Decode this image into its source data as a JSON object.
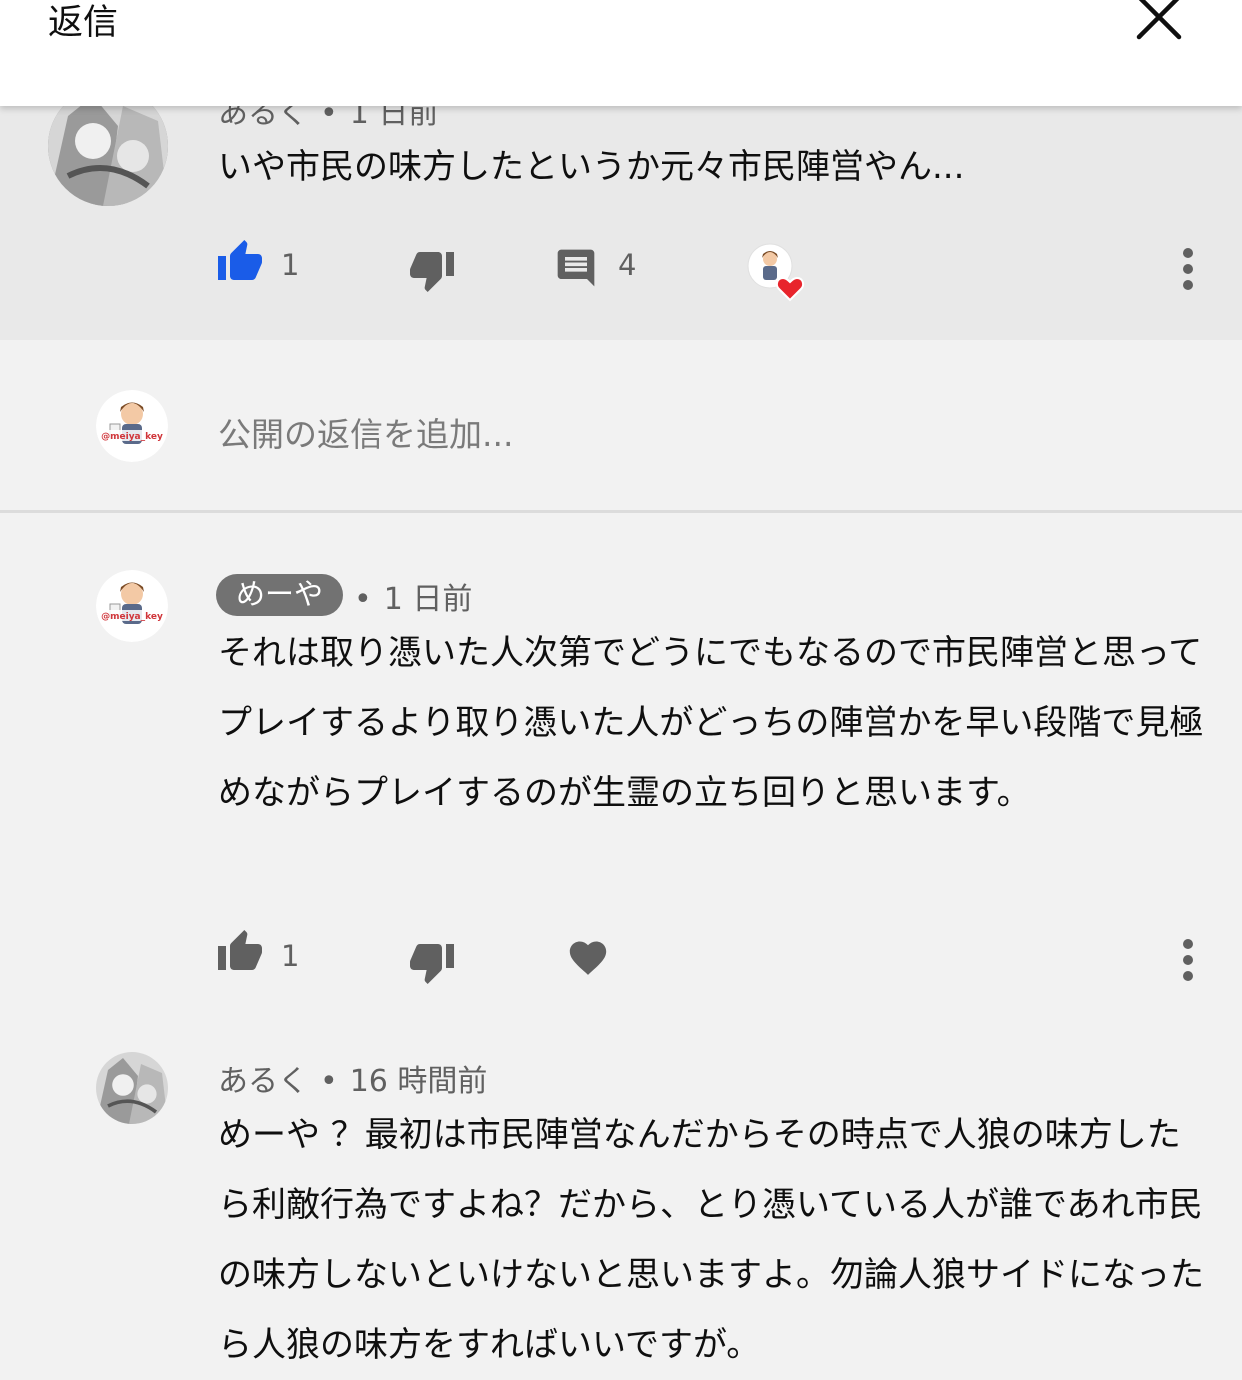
{
  "header": {
    "title": "返信"
  },
  "parent_comment": {
    "author": "あるく",
    "time": "1 日前",
    "text": "いや市民の味方したというか元々市民陣営やん...",
    "likes": "1",
    "replies": "4",
    "liked": true,
    "hearted_by_creator": true
  },
  "compose": {
    "placeholder": "公開の返信を追加..."
  },
  "replies": [
    {
      "author": "めーや",
      "time": "1 日前",
      "text": "それは取り憑いた人次第でどうにでもなるので市民陣営と思ってプレイするより取り憑いた人がどっちの陣営かを早い段階で見極めながらプレイするのが生霊の立ち回りと思います。",
      "likes": "1"
    },
    {
      "author": "あるく",
      "time": "16 時間前",
      "text": "めーや ？最初は市民陣営なんだからその時点で人狼の味方したら利敵行為ですよね？だから、とり憑いている人が誰であれ市民の味方しないといけないと思いますよ。勿論人狼サイドになったら人狼の味方をすればいいですが。"
    }
  ],
  "avatar_watermark": "@meiya_key",
  "colors": {
    "like_active": "#1a5ce8",
    "heart": "#e8242c",
    "icon": "#606060",
    "chip": "#727272"
  }
}
